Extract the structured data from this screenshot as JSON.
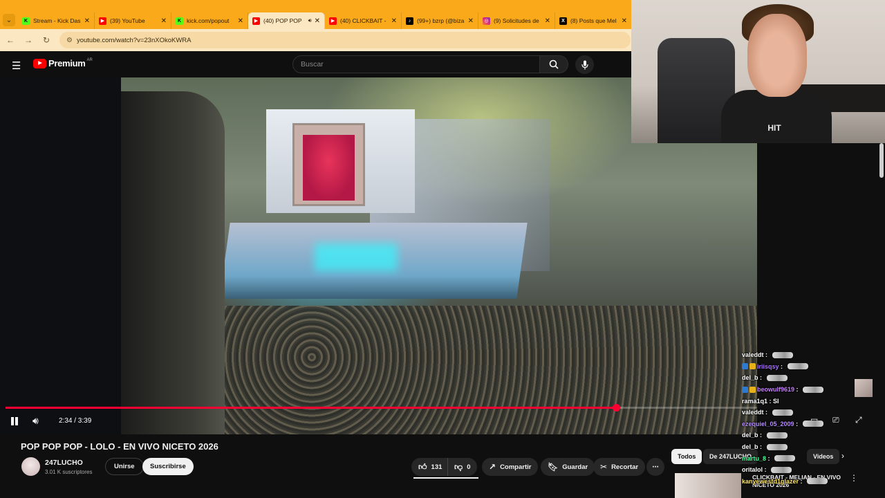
{
  "browser": {
    "tabs": [
      {
        "title": "Stream - Kick Das",
        "icon": "kick"
      },
      {
        "title": "(39) YouTube",
        "icon": "yt"
      },
      {
        "title": "kick.com/popout",
        "icon": "kick"
      },
      {
        "title": "(40) POP POP",
        "icon": "yt",
        "active": true
      },
      {
        "title": "(40) CLICKBAIT - ",
        "icon": "yt"
      },
      {
        "title": "(99+) bzrp (@biza",
        "icon": "tt"
      },
      {
        "title": "(9) Solicitudes de",
        "icon": "ig"
      },
      {
        "title": "(8) Posts que Mel",
        "icon": "xx"
      }
    ],
    "url": "youtube.com/watch?v=23nXOkoKWRA",
    "accent": "#f9a91a"
  },
  "youtube": {
    "logo_text": "Premium",
    "region": "AR",
    "search_placeholder": "Buscar"
  },
  "player": {
    "time": "2:34 / 3:39",
    "progress_fraction": 0.812
  },
  "video": {
    "title": "POP POP POP - LOLO - EN VIVO NICETO 2026",
    "channel": "247LUCHO",
    "subscribers": "3.01 K suscriptores",
    "join_label": "Unirse",
    "subscribe_label": "Suscribirse",
    "likes": "131",
    "dislikes": "0",
    "share_label": "Compartir",
    "save_label": "Guardar",
    "clip_label": "Recortar"
  },
  "chips": {
    "all": "Todos",
    "from": "De 247LUCHO",
    "videos": "Videos"
  },
  "recommendation": {
    "title": "CLICKBAIT - MELIAN - EN VIVO NICETO 2026"
  },
  "webcam": {
    "shirt_text": "HIT"
  },
  "chat": [
    {
      "user": "valeddt",
      "text": "",
      "color": "#ffffff",
      "badges": []
    },
    {
      "user": "iriisqsy",
      "text": "",
      "color": "#a970ff",
      "badges": [
        "b1",
        "b2"
      ]
    },
    {
      "user": "del_b",
      "text": "",
      "color": "#ffffff",
      "badges": []
    },
    {
      "user": "beowulf9619",
      "text": "",
      "color": "#c77dff",
      "badges": [
        "b1",
        "b2"
      ]
    },
    {
      "user": "rama1q1",
      "text": "SI",
      "color": "#ffffff",
      "badges": []
    },
    {
      "user": "valeddt",
      "text": "",
      "color": "#ffffff",
      "badges": []
    },
    {
      "user": "ezequiel_05_2009",
      "text": "",
      "color": "#b58cff",
      "badges": []
    },
    {
      "user": "del_b",
      "text": "",
      "color": "#ffffff",
      "badges": []
    },
    {
      "user": "del_b",
      "text": "",
      "color": "#ffffff",
      "badges": []
    },
    {
      "user": "martu_8",
      "text": "",
      "color": "#4dff9a",
      "badges": []
    },
    {
      "user": "oritalol",
      "text": "",
      "color": "#ffffff",
      "badges": []
    },
    {
      "user": "kanyewestd1glazer",
      "text": "",
      "color": "#ffe86b",
      "badges": []
    }
  ]
}
